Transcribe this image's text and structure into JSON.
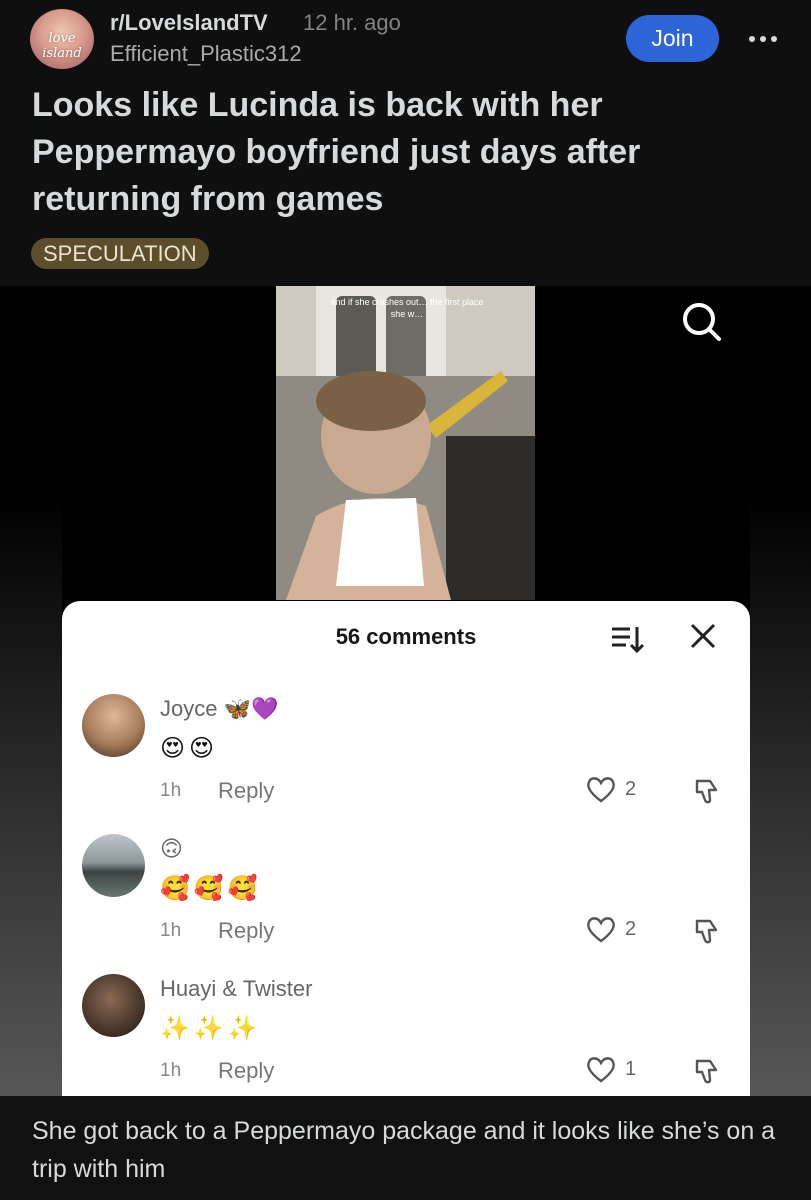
{
  "post": {
    "subreddit": "r/LoveIslandTV",
    "time_ago": "12 hr. ago",
    "username": "Efficient_Plastic312",
    "avatar_logo_text": "love island",
    "join_label": "Join",
    "title": "Looks like Lucinda is back with her Peppermayo boyfriend just days after returning from games",
    "flair": "SPECULATION",
    "body": "She got back to a Peppermayo package and it looks like she’s on a trip with him"
  },
  "media": {
    "video_caption": "and if she crashes out… the first place she w…",
    "comments_sheet": {
      "title": "56 comments",
      "comments": [
        {
          "name": "Joyce",
          "name_emoji": "🦋💜",
          "text": "😍😍",
          "time": "1h",
          "reply": "Reply",
          "likes": "2"
        },
        {
          "name": "",
          "name_emoji": "🙃",
          "text": "🥰🥰🥰",
          "time": "1h",
          "reply": "Reply",
          "likes": "2"
        },
        {
          "name": "Huayi & Twister",
          "name_emoji": "",
          "text": "✨✨✨",
          "time": "1h",
          "reply": "Reply",
          "likes": "1"
        }
      ]
    }
  },
  "colors": {
    "join_button": "#2d65d8",
    "flair_bg": "#5c4e2a",
    "background": "#0f0f0f"
  },
  "icons": [
    "more-icon",
    "search-icon",
    "sort-icon",
    "close-icon",
    "heart-icon",
    "dislike-icon"
  ]
}
